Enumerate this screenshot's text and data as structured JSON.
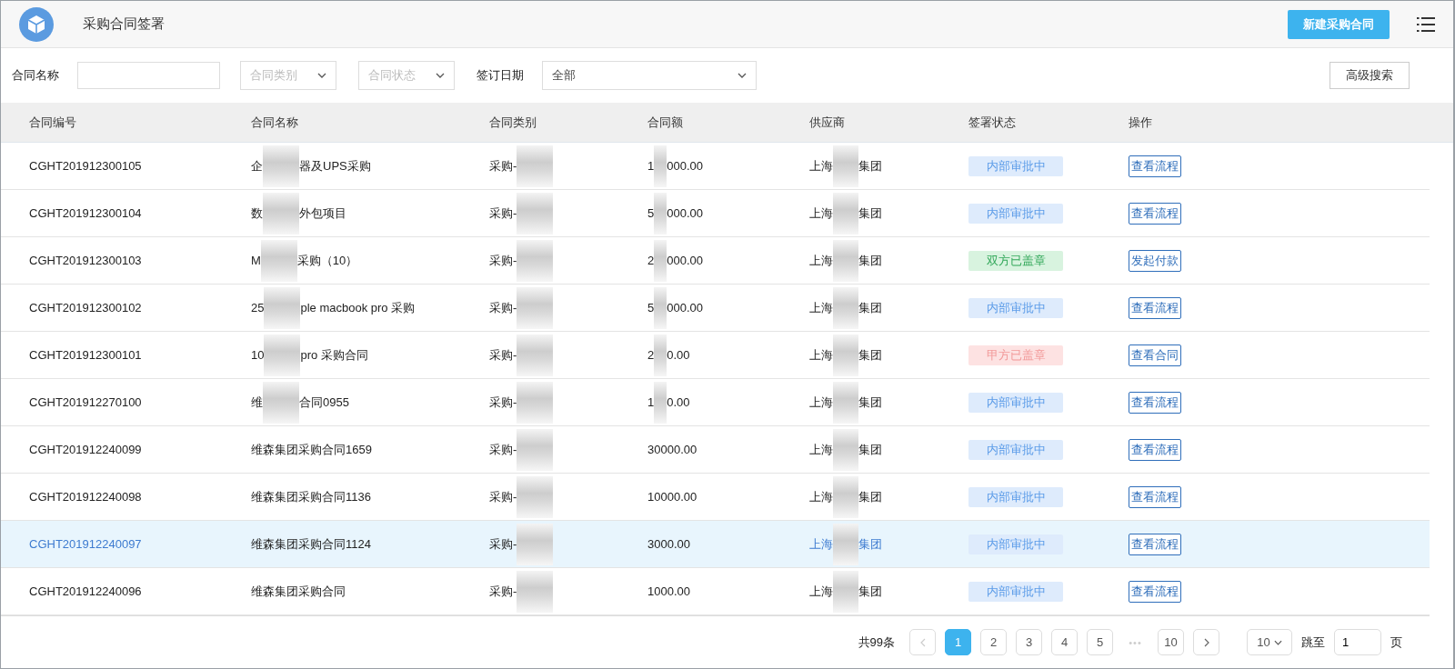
{
  "header": {
    "title": "采购合同签署",
    "new_button": "新建采购合同"
  },
  "filters": {
    "name_label": "合同名称",
    "category_placeholder": "合同类别",
    "status_placeholder": "合同状态",
    "date_label": "签订日期",
    "date_value": "全部",
    "advanced_button": "高级搜索"
  },
  "table": {
    "columns": [
      "合同编号",
      "合同名称",
      "合同类别",
      "合同额",
      "供应商",
      "签署状态",
      "操作"
    ],
    "rows": [
      {
        "selected": false,
        "code": "CGHT201912300105",
        "name": [
          "企",
          "器及UPS采购"
        ],
        "category": "采购-",
        "amount": [
          "1",
          "000.00"
        ],
        "supplier": [
          "上海",
          "集团"
        ],
        "status": {
          "kind": "approving",
          "label": "内部审批中"
        },
        "action": "查看流程"
      },
      {
        "selected": false,
        "code": "CGHT201912300104",
        "name": [
          "数",
          "外包项目"
        ],
        "category": "采购-",
        "amount": [
          "5",
          "000.00"
        ],
        "supplier": [
          "上海",
          "集团"
        ],
        "status": {
          "kind": "approving",
          "label": "内部审批中"
        },
        "action": "查看流程"
      },
      {
        "selected": false,
        "code": "CGHT201912300103",
        "name": [
          "M",
          "采购（10）"
        ],
        "category": "采购-",
        "amount": [
          "2",
          "000.00"
        ],
        "supplier": [
          "上海",
          "集团"
        ],
        "status": {
          "kind": "both_sealed",
          "label": "双方已盖章"
        },
        "action": "发起付款"
      },
      {
        "selected": false,
        "code": "CGHT201912300102",
        "name": [
          "25",
          "ple macbook pro 采购"
        ],
        "category": "采购-",
        "amount": [
          "5",
          "000.00"
        ],
        "supplier": [
          "上海",
          "集团"
        ],
        "status": {
          "kind": "approving",
          "label": "内部审批中"
        },
        "action": "查看流程"
      },
      {
        "selected": false,
        "code": "CGHT201912300101",
        "name": [
          "10",
          "pro 采购合同"
        ],
        "category": "采购-",
        "amount": [
          "2",
          "0.00"
        ],
        "supplier": [
          "上海",
          "集团"
        ],
        "status": {
          "kind": "party_a_sealed",
          "label": "甲方已盖章"
        },
        "action": "查看合同"
      },
      {
        "selected": false,
        "code": "CGHT201912270100",
        "name": [
          "维",
          "合同0955"
        ],
        "category": "采购-",
        "amount": [
          "1",
          "0.00"
        ],
        "supplier": [
          "上海",
          "集团"
        ],
        "status": {
          "kind": "approving",
          "label": "内部审批中"
        },
        "action": "查看流程"
      },
      {
        "selected": false,
        "code": "CGHT201912240099",
        "name": [
          "维森集团采购合同1659"
        ],
        "category": "采购-",
        "amount": [
          "30000.00"
        ],
        "supplier": [
          "上海",
          "集团"
        ],
        "status": {
          "kind": "approving",
          "label": "内部审批中"
        },
        "action": "查看流程"
      },
      {
        "selected": false,
        "code": "CGHT201912240098",
        "name": [
          "维森集团采购合同1136"
        ],
        "category": "采购-",
        "amount": [
          "10000.00"
        ],
        "supplier": [
          "上海",
          "集团"
        ],
        "status": {
          "kind": "approving",
          "label": "内部审批中"
        },
        "action": "查看流程"
      },
      {
        "selected": true,
        "code": "CGHT201912240097",
        "name": [
          "维森集团采购合同1124"
        ],
        "category": "采购-",
        "amount": [
          "3000.00"
        ],
        "supplier": [
          "上海",
          "集团"
        ],
        "status": {
          "kind": "approving",
          "label": "内部审批中"
        },
        "action": "查看流程"
      },
      {
        "selected": false,
        "code": "CGHT201912240096",
        "name": [
          "维森集团采购合同"
        ],
        "category": "采购-",
        "amount": [
          "1000.00"
        ],
        "supplier": [
          "上海",
          "集团"
        ],
        "status": {
          "kind": "approving",
          "label": "内部审批中"
        },
        "action": "查看流程"
      }
    ]
  },
  "pagination": {
    "total": "共99条",
    "pages": [
      {
        "label": "1",
        "selected": true
      },
      {
        "label": "2",
        "selected": false
      },
      {
        "label": "3",
        "selected": false
      },
      {
        "label": "4",
        "selected": false
      },
      {
        "label": "5",
        "selected": false
      },
      {
        "label": "•••",
        "kind": "ellipsis"
      },
      {
        "label": "10",
        "selected": false
      }
    ],
    "page_size": "10",
    "jump_label": "跳至",
    "jump_value": "1",
    "page_unit": "页"
  }
}
